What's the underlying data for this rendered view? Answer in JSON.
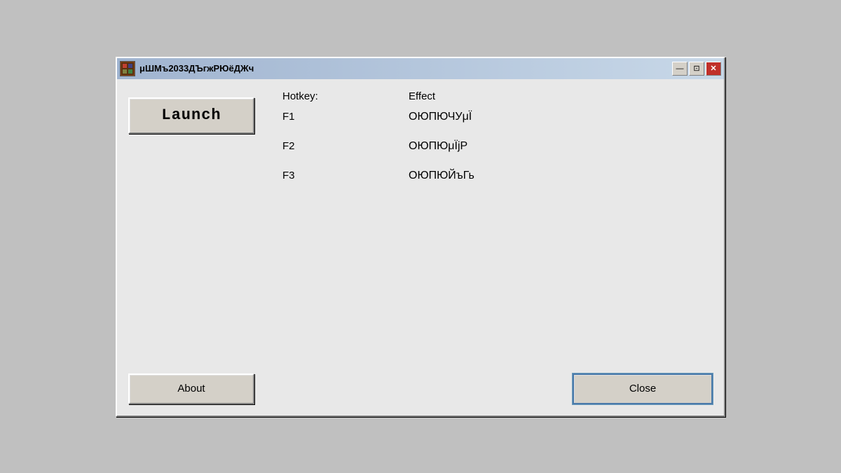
{
  "window": {
    "title": "μШМъ2033ДЪгжРЮёДЖч",
    "icon": "app-icon"
  },
  "titlebar": {
    "minimize_label": "—",
    "restore_label": "⊡",
    "close_label": "✕"
  },
  "buttons": {
    "launch_label": "Launch",
    "about_label": "About",
    "close_label": "Close"
  },
  "table": {
    "header_hotkey": "Hotkey:",
    "header_effect": "Effect",
    "rows": [
      {
        "hotkey": "F1",
        "effect": "ОЮПЮЧУμЇ"
      },
      {
        "hotkey": "F2",
        "effect": "ОЮПЮμЇjР"
      },
      {
        "hotkey": "F3",
        "effect": "ОЮПЮЙъГь"
      }
    ]
  }
}
